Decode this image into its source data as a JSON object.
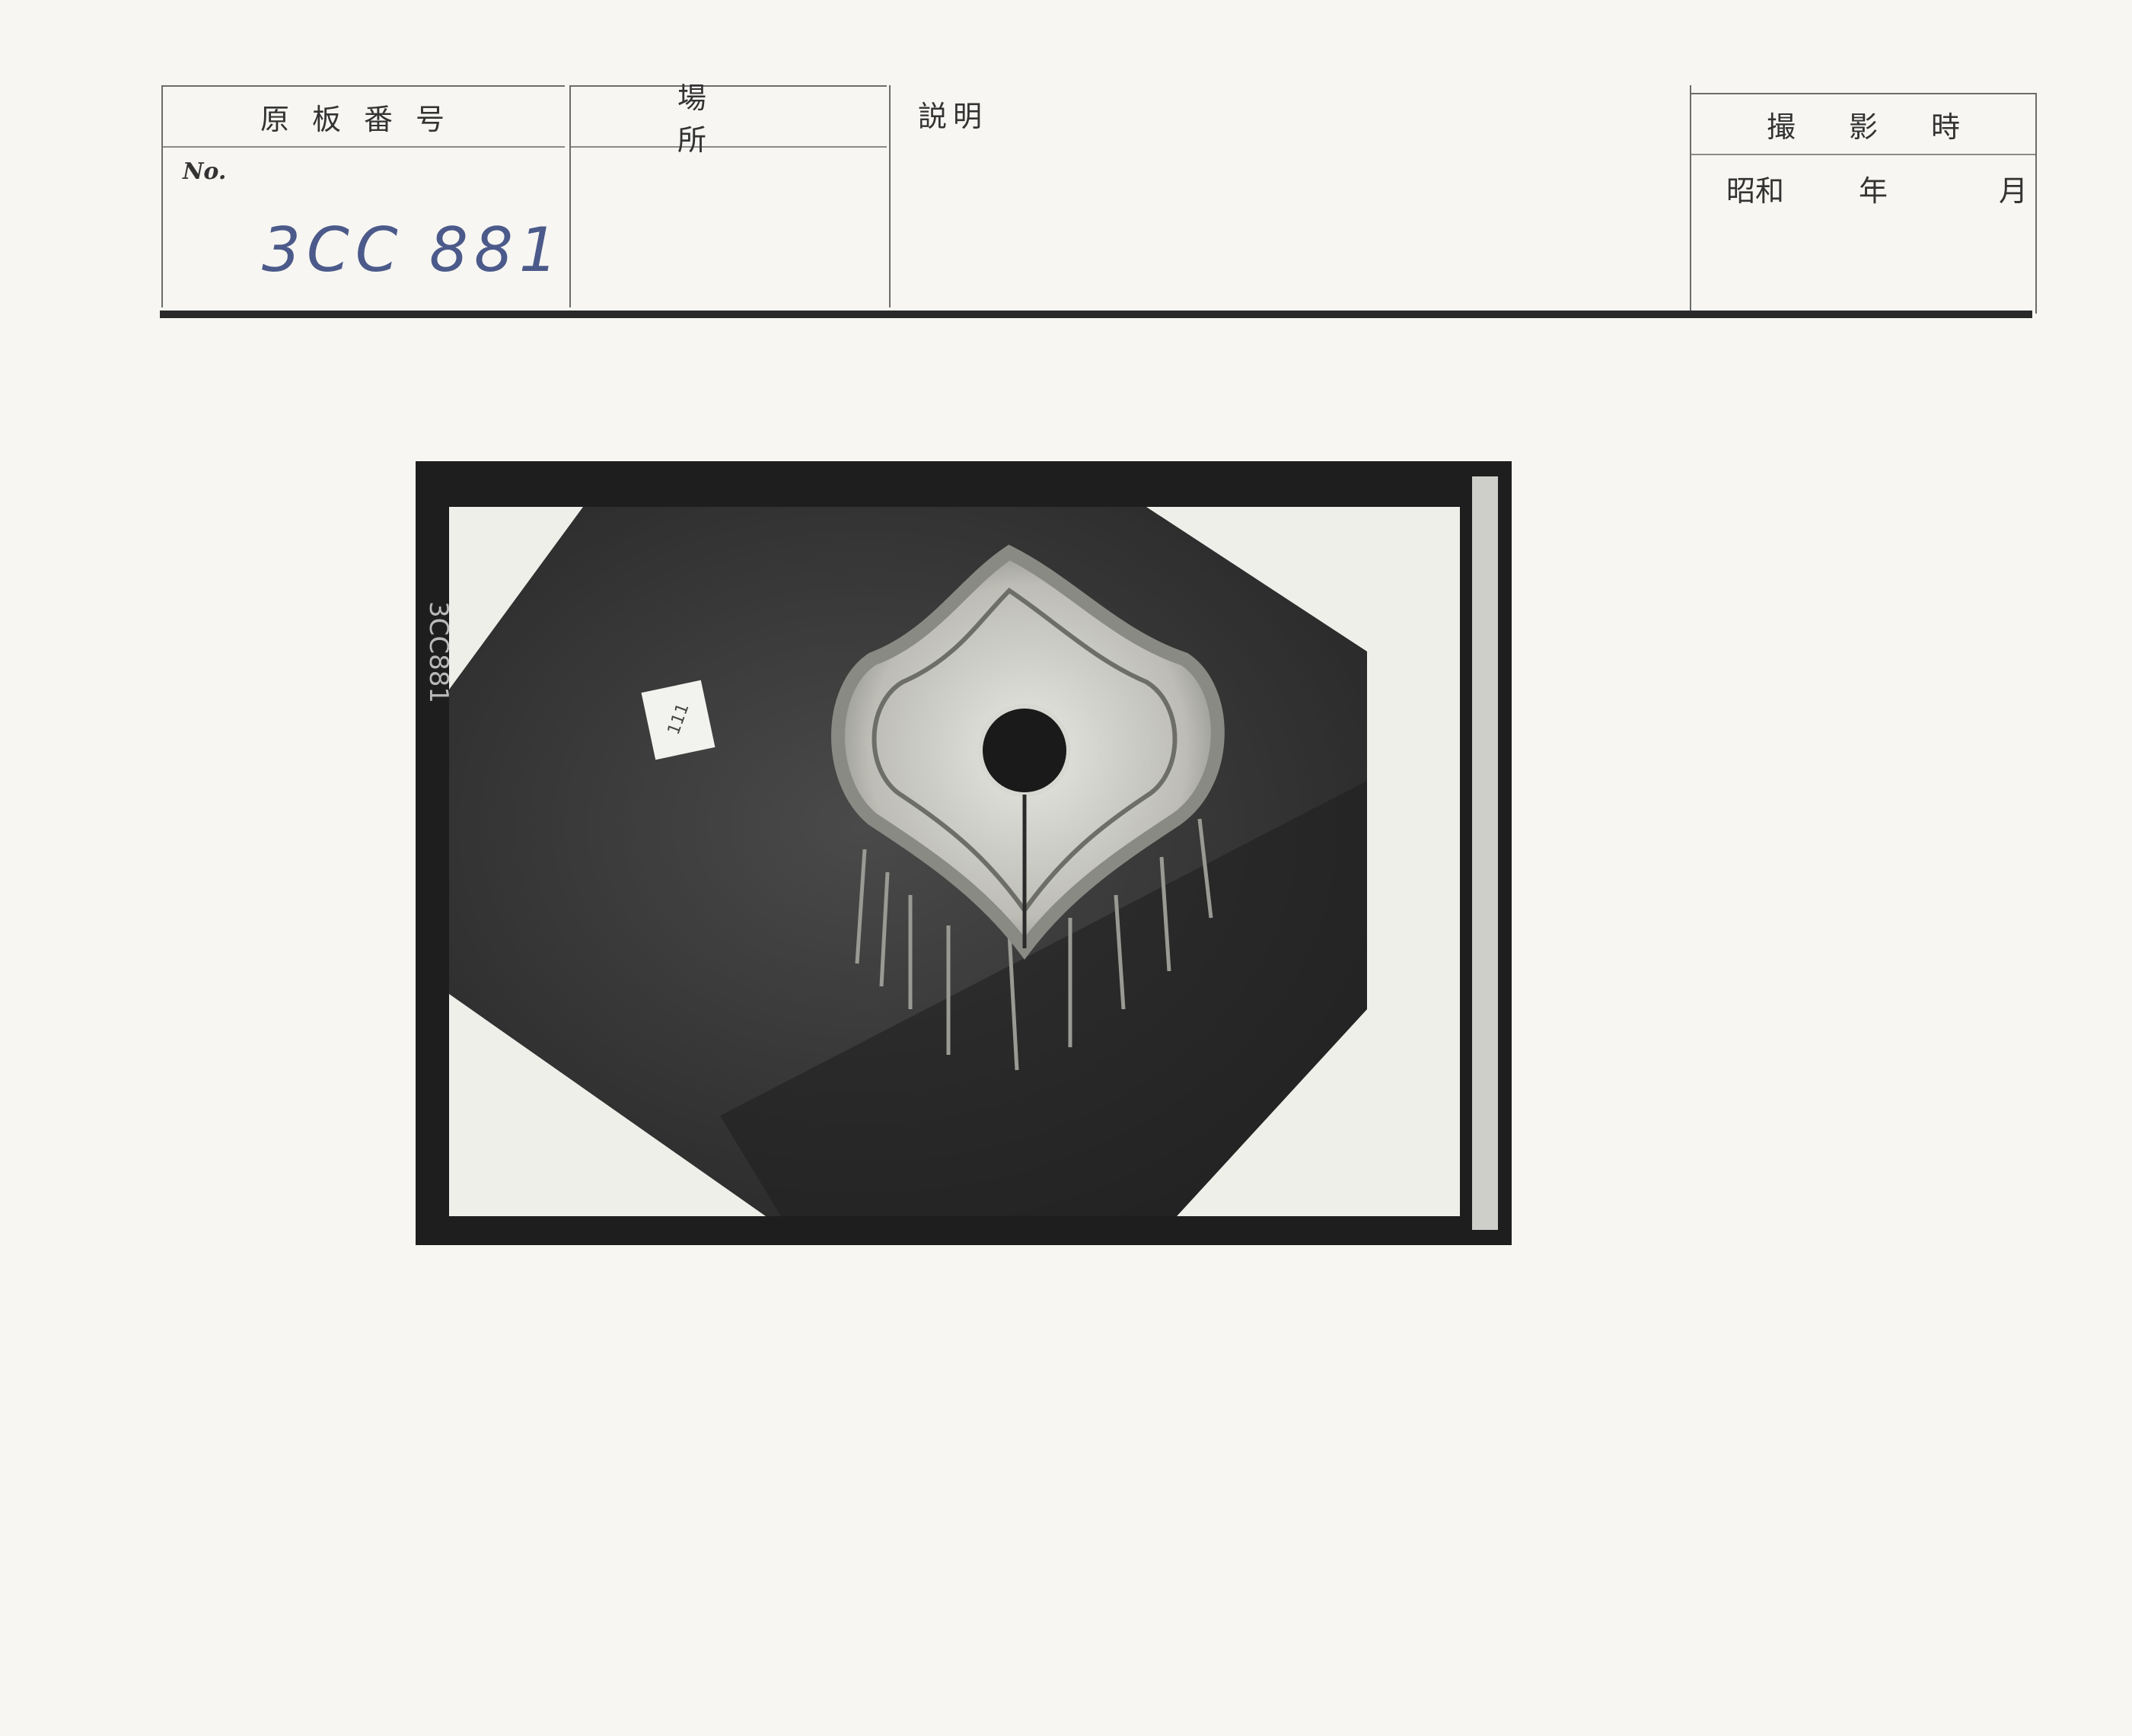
{
  "form": {
    "no_header": "原板番号",
    "place_header": "場所",
    "desc_header": "説明",
    "date_header": "撮影時",
    "no_label": "No.",
    "no_value": "3CC 881",
    "date_era": "昭和",
    "date_year": "年",
    "date_month": "月",
    "place_value": "",
    "desc_value": ""
  },
  "photo": {
    "tag_number": "111",
    "edge_number": "3CC881",
    "subject_icon": "embroidered-collar-photo"
  },
  "colors": {
    "paper": "#f7f6f2",
    "ink": "#333333",
    "handwriting": "#4b5a8a",
    "rule": "#2a2a2a"
  }
}
